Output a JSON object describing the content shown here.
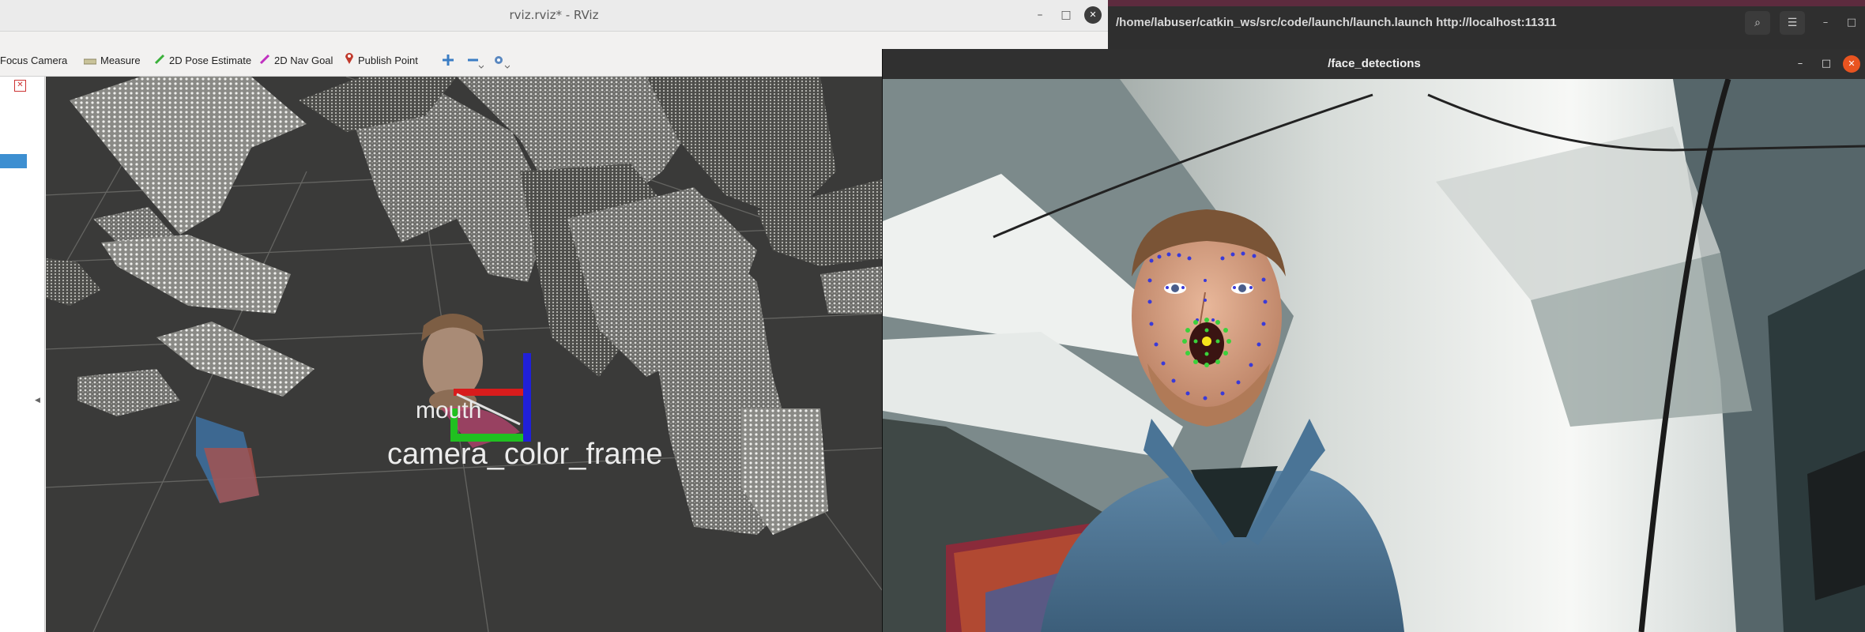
{
  "rviz": {
    "title": "rviz.rviz* - RViz",
    "window_controls": {
      "minimize": "–",
      "maximize": "□",
      "close": "✕"
    },
    "toolbar": {
      "focus_camera": "Focus Camera",
      "measure": "Measure",
      "pose_estimate": "2D Pose Estimate",
      "nav_goal": "2D Nav Goal",
      "publish_point": "Publish Point"
    },
    "left_panel_close": "✕",
    "viewport": {
      "frame_labels": {
        "mouth": "mouth",
        "camera": "camera_color_frame"
      }
    }
  },
  "terminal": {
    "title": "/home/labuser/catkin_ws/src/code/launch/launch.launch http://localhost:11311",
    "controls": {
      "search": "⌕",
      "menu": "☰",
      "minimize": "–",
      "maximize": "□"
    }
  },
  "face_window": {
    "title": "/face_detections",
    "controls": {
      "minimize": "–",
      "maximize": "□",
      "close": "✕"
    }
  },
  "colors": {
    "rviz_bg": "#f2f1f0",
    "viewport_bg": "#3a3a39",
    "terminal_bg": "#2f2f2f",
    "terminal_accent": "#5d2b3e",
    "close_orange": "#e95420",
    "landmark_blue": "#3a3ad8",
    "mouth_green": "#3bd23b",
    "mouth_center_yellow": "#f5e51b"
  }
}
